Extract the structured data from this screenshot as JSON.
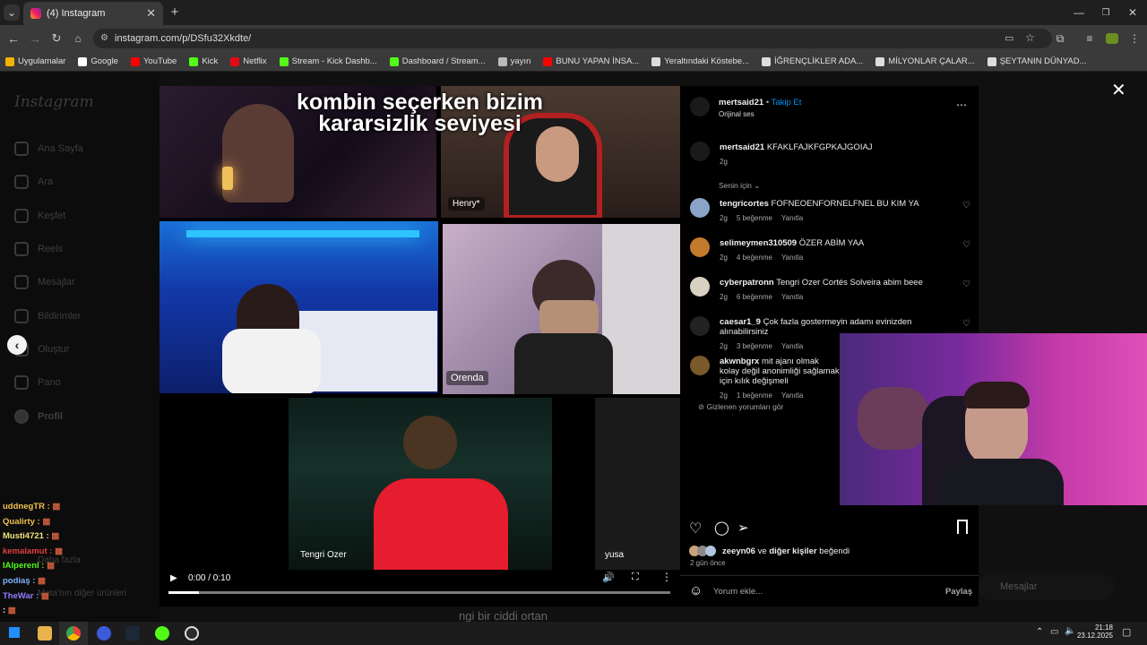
{
  "browser": {
    "tab_title": "(4) Instagram",
    "url": "instagram.com/p/DSfu32Xkdte/",
    "bookmarks": [
      {
        "label": "Uygulamalar",
        "color": "#f2b400"
      },
      {
        "label": "Google",
        "color": "#ffffff"
      },
      {
        "label": "YouTube",
        "color": "#ff0000"
      },
      {
        "label": "Kick",
        "color": "#53fc18"
      },
      {
        "label": "Netflix",
        "color": "#e50914"
      },
      {
        "label": "Stream - Kick Dashb...",
        "color": "#53fc18"
      },
      {
        "label": "Dashboard / Stream...",
        "color": "#53fc18"
      },
      {
        "label": "yayın",
        "color": "#bbbbbb"
      },
      {
        "label": "BUNU YAPAN İNSA...",
        "color": "#ff0000"
      },
      {
        "label": "Yeraltındaki Köstebe...",
        "color": "#dddddd"
      },
      {
        "label": "İĞRENÇLİKLER ADA...",
        "color": "#dddddd"
      },
      {
        "label": "MİLYONLAR ÇALAR...",
        "color": "#dddddd"
      },
      {
        "label": "ŞEYTANIN DÜNYAD...",
        "color": "#dddddd"
      }
    ]
  },
  "instagram": {
    "logo": "Instagram",
    "nav": [
      "Ana Sayfa",
      "Ara",
      "Keşfet",
      "Reels",
      "Mesajlar",
      "Bildirimler",
      "Oluştur",
      "Pano",
      "Profil"
    ],
    "more": "Daha fazla",
    "other_products": "Meta'nın diğer ürünleri",
    "messages_bar": "Mesajlar"
  },
  "video": {
    "caption_line1": "kombin seçerken bizim",
    "caption_line2": "kararsizlik seviyesi",
    "names": [
      "Henry*",
      "Orenda",
      "Tengri Ozer",
      "yusa"
    ],
    "timecode": "0:00 / 0:10",
    "progress": 0.06,
    "subtitle_fragment": "ngi bir ciddi ortan"
  },
  "post": {
    "author": "mertsaid21",
    "follow": "Takip Et",
    "audio": "Orijinal ses",
    "caption_user": "mertsaid21",
    "caption_text": "KFAKLFAJKFGPKAJGOIAJ",
    "caption_age": "2g",
    "sort_label": "Senin için",
    "comments": [
      {
        "user": "tengricortes",
        "text": "FOFNEOENFORNELFNEL BU KIM YA",
        "age": "2g",
        "likes": "5 beğenme",
        "reply": "Yanıtla"
      },
      {
        "user": "selimeymen310509",
        "text": "ÖZER ABİM YAA",
        "age": "2g",
        "likes": "4 beğenme",
        "reply": "Yanıtla"
      },
      {
        "user": "cyberpatronn",
        "text": "Tengri Ozer Cortés Solveira abim beee",
        "age": "2g",
        "likes": "6 beğenme",
        "reply": "Yanıtla"
      },
      {
        "user": "caesar1_9",
        "text": "Çok fazla gostermeyin adamı evinizden alınabilirsiniz",
        "age": "2g",
        "likes": "3 beğenme",
        "reply": "Yanıtla"
      },
      {
        "user": "akwnbgrx",
        "text": "mit ajanı olmak kolay değil anonimliği sağlamak için kılık değişmeli",
        "age": "2g",
        "likes": "1 beğenme",
        "reply": "Yanıtla"
      }
    ],
    "hidden_comments": "Gizlenen yorumları gör",
    "liked_by_user": "zeeyn06",
    "liked_by_rest": "ve",
    "liked_by_others": "diğer kişiler",
    "liked_suffix": "beğendi",
    "posted": "2 gün önce",
    "comment_placeholder": "Yorum ekle...",
    "share": "Paylaş"
  },
  "chat": [
    {
      "user": "uddnegTR :",
      "color": "#f2c14e"
    },
    {
      "user": "Qualirty :",
      "color": "#f2c14e"
    },
    {
      "user": "Musti4721 :",
      "color": "#f2e27a"
    },
    {
      "user": "kemalamut :",
      "color": "#e0413a"
    },
    {
      "user": "IAlperenl :",
      "color": "#53fc18"
    },
    {
      "user": "podiaş :",
      "color": "#7fb3ff"
    },
    {
      "user": "TheWar :",
      "color": "#8e7dff"
    },
    {
      "user": ":",
      "color": "#ffffff"
    }
  ],
  "taskbar": {
    "time": "21:18",
    "date": "23.12.2025"
  },
  "colors": {
    "accent": "#0095f6",
    "bg": "#000000"
  }
}
